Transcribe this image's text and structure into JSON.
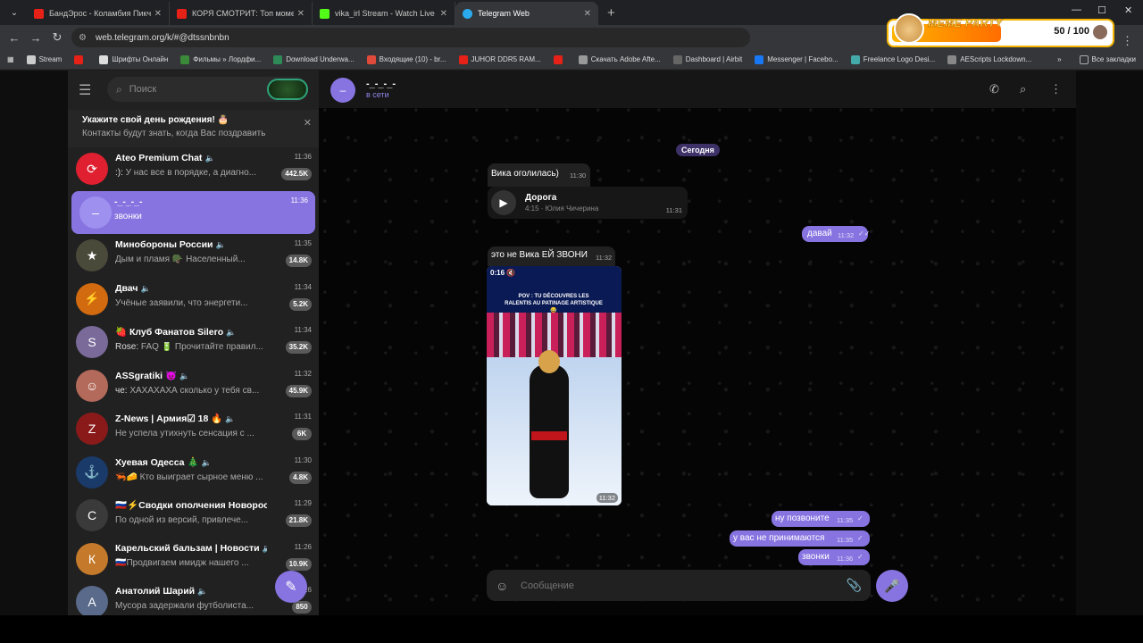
{
  "browser": {
    "tabs": [
      {
        "title": "БандЭрос - Коламбия Пикчерс",
        "color": "#e62117"
      },
      {
        "title": "КОРЯ СМОТРИТ: Топ моментов",
        "color": "#e62117"
      },
      {
        "title": "vika_irl Stream - Watch Live",
        "color": "#53fc18"
      },
      {
        "title": "Telegram Web",
        "color": "#2aabee"
      }
    ],
    "url": "web.telegram.org/k/#@dtssnbnbn",
    "bookmarks": [
      "Stream",
      "",
      "Шрифты Онлайн",
      "Фильмы » Лордфи...",
      "Download Underwa...",
      "Входящие (10) - br...",
      "JUHOR DDR5 RAM...",
      "",
      "Скачать Adobe Afte...",
      "Dashboard | Airbit",
      "Messenger | Facebo...",
      "Freelance Logo Desi...",
      "AEScripts Lockdown..."
    ],
    "all_bookmarks": "Все закладки"
  },
  "meme": {
    "title": "MEME PARTY",
    "score": "50 / 100",
    "progress": 0.5
  },
  "sidebar": {
    "search_placeholder": "Поиск",
    "birthday": {
      "title": "Укажите свой день рождения! 🎂",
      "text": "Контакты будут знать, когда Вас поздравить"
    },
    "chats": [
      {
        "name": "Ateo Premium Chat",
        "time": "11:36",
        "sender": ":):",
        "msg": "У нас все в порядке, а диагно...",
        "count": "442.5K",
        "avcolor": "#e02030",
        "avtext": "⟳"
      },
      {
        "name": "-_-_-_-",
        "time": "11:36",
        "sender": "",
        "msg": "звонки",
        "count": "",
        "avcolor": "#9e90ee",
        "avtext": "–",
        "selected": true
      },
      {
        "name": "Минобороны России",
        "time": "11:35",
        "sender": "",
        "msg": "Дым и пламя 🪖 Населенный...",
        "count": "14.8K",
        "avcolor": "#4a4a3a",
        "avtext": "★"
      },
      {
        "name": "Двач",
        "time": "11:34",
        "sender": "",
        "msg": "Учёные заявили, что энергети...",
        "count": "5.2K",
        "avcolor": "#d26b10",
        "avtext": "⚡"
      },
      {
        "name": "🍓 Клуб Фанатов Silero",
        "time": "11:34",
        "sender": "Rose:",
        "msg": "FAQ 🔋 Прочитайте правил...",
        "count": "35.2K",
        "avcolor": "#7a6a9a",
        "avtext": "S"
      },
      {
        "name": "ASSgratiki 😈",
        "time": "11:32",
        "sender": "чe:",
        "msg": "ХАХАХАХА сколько у тебя св...",
        "count": "45.9K",
        "avcolor": "#b46a5a",
        "avtext": "☺"
      },
      {
        "name": "Z-News | Армия☑ 18 🔥",
        "time": "11:31",
        "sender": "",
        "msg": "Не успела утихнуть сенсация с ...",
        "count": "6K",
        "avcolor": "#8a1a1a",
        "avtext": "Z"
      },
      {
        "name": "Хуевая Одесса 🎄",
        "time": "11:30",
        "sender": "",
        "msg": "🦐🧀 Кто выиграет сырное меню ...",
        "count": "4.8K",
        "avcolor": "#1a3a6a",
        "avtext": "⚓"
      },
      {
        "name": "🇷🇺⚡Сводки ополчения Новорос...",
        "time": "11:29",
        "sender": "",
        "msg": "По одной из версий, привлече...",
        "count": "21.8K",
        "avcolor": "#3a3a3a",
        "avtext": "С"
      },
      {
        "name": "Карельский бальзам | Новости",
        "time": "11:26",
        "sender": "",
        "msg": "🇷🇺Продвигаем имидж нашего ...",
        "count": "10.9K",
        "avcolor": "#c47a2a",
        "avtext": "К"
      },
      {
        "name": "Анатолий Шарий",
        "time": "11:26",
        "sender": "",
        "msg": "Мусора задержали футболиста...",
        "count": "850",
        "avcolor": "#5a6a8a",
        "avtext": "А"
      }
    ]
  },
  "chat": {
    "name": "-_-_-_-",
    "status": "в сети",
    "date": "Сегодня",
    "in1": {
      "text": "Вика оголилась)",
      "time": "11:30"
    },
    "audio": {
      "title": "Дорога",
      "meta": "4:15 · Юлия Чичерина",
      "time": "11:31"
    },
    "out1": {
      "text": "давай",
      "time": "11:32"
    },
    "in2": {
      "text": "это не Вика ЕЙ ЗВОНИ",
      "time": "11:32"
    },
    "video": {
      "duration": "0:16",
      "caption": "POV : TU DÉCOUVRES LES RALENTIS AU PATINAGE ARTISTIQUE 😂",
      "time": "11:32"
    },
    "out2": {
      "text": "ну позвоните",
      "time": "11:35"
    },
    "out3": {
      "text": "у вас не принимаются",
      "time": "11:35"
    },
    "out4": {
      "text": "звонки",
      "time": "11:36"
    },
    "composer_placeholder": "Сообщение"
  }
}
